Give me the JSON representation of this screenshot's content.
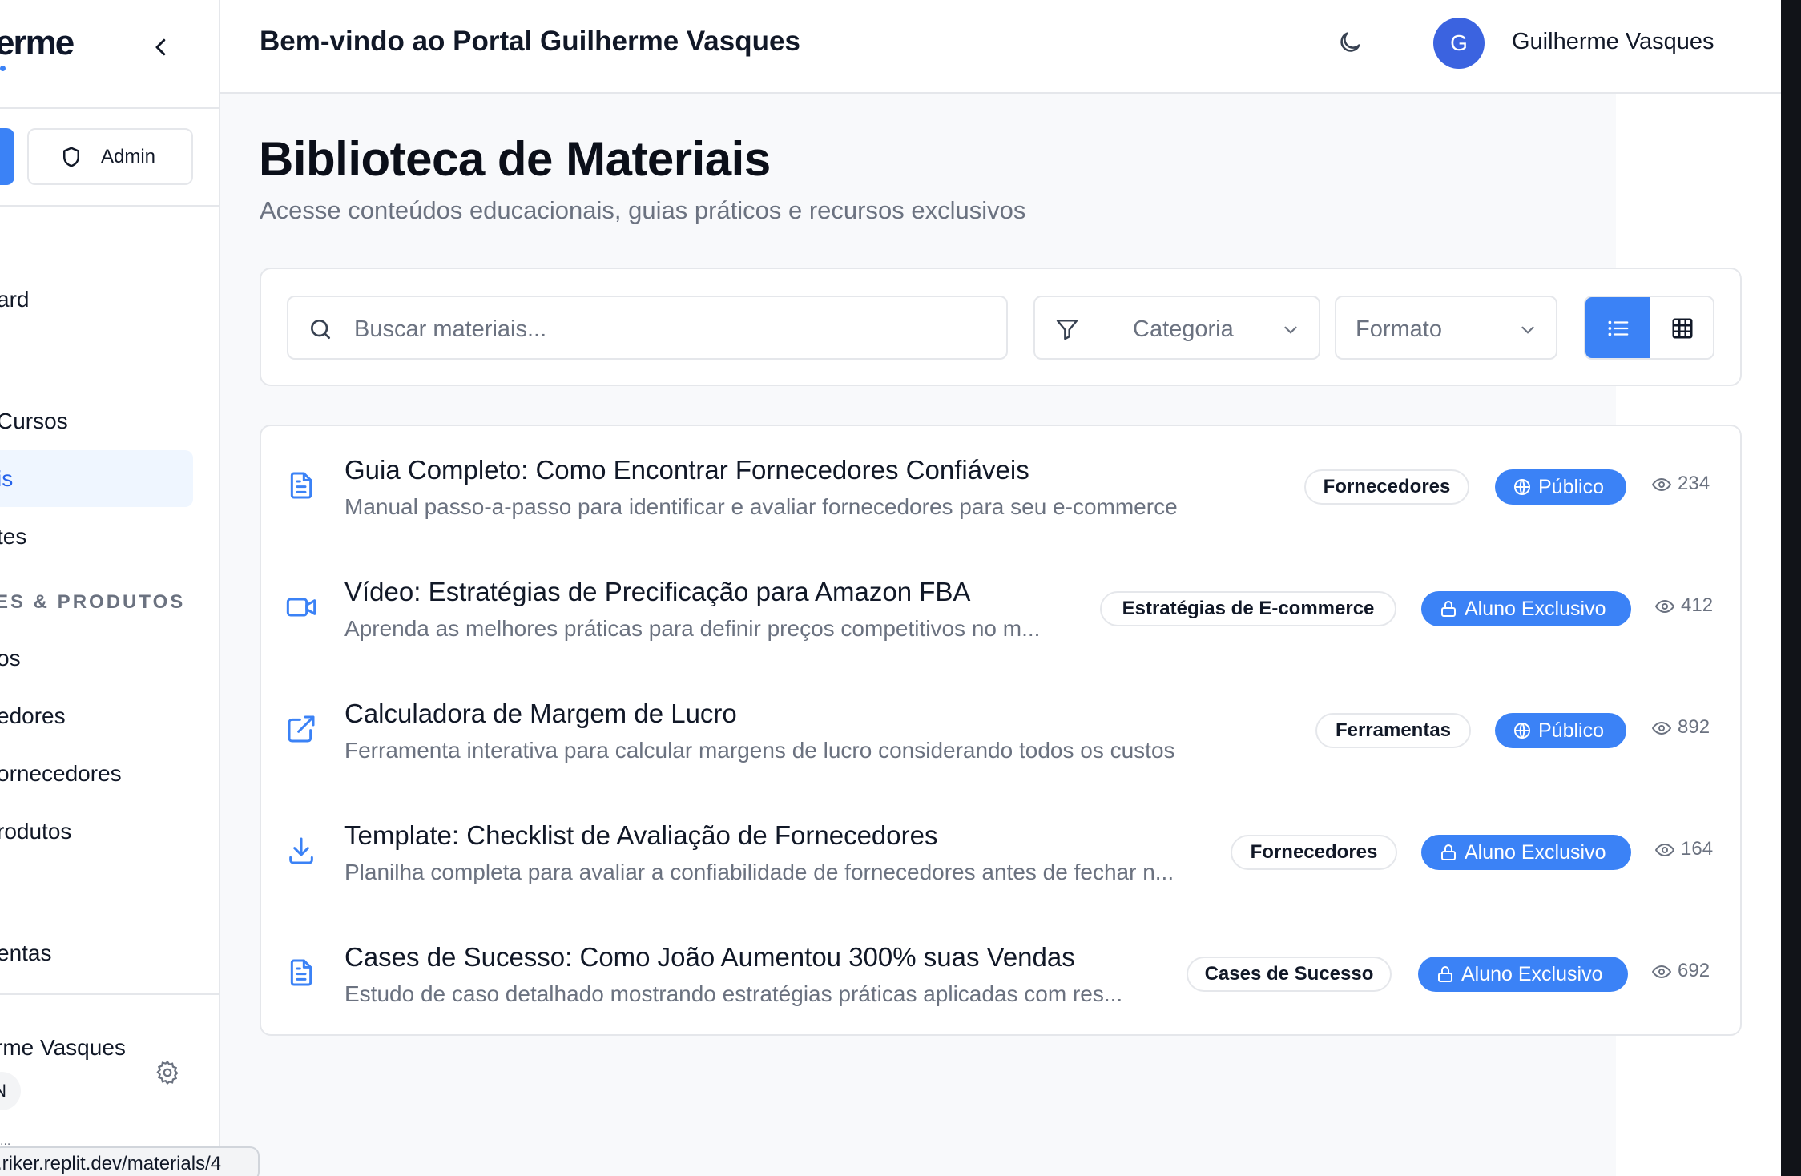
{
  "sidebar": {
    "logo_text": "erme",
    "admin_label": "Admin",
    "nav": [
      {
        "label": "ard"
      },
      {
        "label": " Cursos"
      },
      {
        "label": "is"
      },
      {
        "label": "tes"
      },
      {
        "label": "os"
      },
      {
        "label": "edores"
      },
      {
        "label": "ornecedores"
      },
      {
        "label": "rodutos"
      },
      {
        "label": "entas"
      }
    ],
    "section_label": "ES & PRODUTOS",
    "user_name": "rme Vasques",
    "user_badge": "N",
    "dots": "..."
  },
  "header": {
    "welcome": "Bem-vindo ao Portal Guilherme Vasques",
    "avatar_initial": "G",
    "user_name": "Guilherme Vasques"
  },
  "page": {
    "title": "Biblioteca de Materiais",
    "subtitle": "Acesse conteúdos educacionais, guias práticos e recursos exclusivos"
  },
  "filters": {
    "search_placeholder": "Buscar materiais...",
    "category_label": "Categoria",
    "format_label": "Formato",
    "view_mode": "list"
  },
  "materials": [
    {
      "icon": "document-icon",
      "title": "Guia Completo: Como Encontrar Fornecedores Confiáveis",
      "description": "Manual passo-a-passo para identificar e avaliar fornecedores para seu e-commerce",
      "category": "Fornecedores",
      "access": "Público",
      "access_icon": "globe-icon",
      "views": "234"
    },
    {
      "icon": "video-icon",
      "title": "Vídeo: Estratégias de Precificação para Amazon FBA",
      "description": "Aprenda as melhores práticas para definir preços competitivos no m...",
      "category": "Estratégias de E-commerce",
      "access": "Aluno Exclusivo",
      "access_icon": "lock-icon",
      "views": "412"
    },
    {
      "icon": "external-link-icon",
      "title": "Calculadora de Margem de Lucro",
      "description": "Ferramenta interativa para calcular margens de lucro considerando todos os custos",
      "category": "Ferramentas",
      "access": "Público",
      "access_icon": "globe-icon",
      "views": "892"
    },
    {
      "icon": "download-icon",
      "title": "Template: Checklist de Avaliação de Fornecedores",
      "description": "Planilha completa para avaliar a confiabilidade de fornecedores antes de fechar n...",
      "category": "Fornecedores",
      "access": "Aluno Exclusivo",
      "access_icon": "lock-icon",
      "views": "164"
    },
    {
      "icon": "document-icon",
      "title": "Cases de Sucesso: Como João Aumentou 300% suas Vendas",
      "description": "Estudo de caso detalhado mostrando estratégias práticas aplicadas com res...",
      "category": "Cases de Sucesso",
      "access": "Aluno Exclusivo",
      "access_icon": "lock-icon",
      "views": "692"
    }
  ],
  "status_bar": {
    "url": ".riker.replit.dev/materials/4"
  },
  "colors": {
    "accent": "#3b82f6",
    "avatar": "#3b63e0",
    "muted_text": "#6b7280",
    "border": "#e5e7eb"
  }
}
